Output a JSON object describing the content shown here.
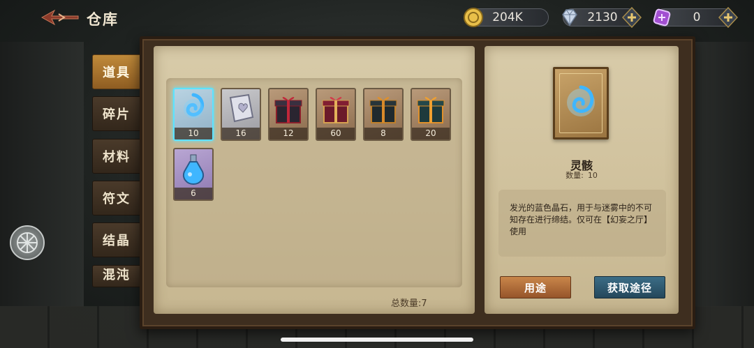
{
  "header": {
    "title": "仓库"
  },
  "resources": {
    "gold": {
      "value": "204K",
      "icon": "coin-icon",
      "color": "#e9c04a"
    },
    "gems": {
      "value": "2130",
      "icon": "diamond-icon",
      "color": "#c9d6e8"
    },
    "orbs": {
      "value": "0",
      "icon": "purple-crystal-icon",
      "color": "#a24fd1"
    }
  },
  "tabs": [
    {
      "label": "道具",
      "active": true
    },
    {
      "label": "碎片",
      "active": false
    },
    {
      "label": "材料",
      "active": false
    },
    {
      "label": "符文",
      "active": false
    },
    {
      "label": "结晶",
      "active": false
    },
    {
      "label": "混沌",
      "active": false
    }
  ],
  "items": [
    {
      "name": "spirit-remains",
      "count": "10",
      "selected": true,
      "icon": "blue-spirit-icon"
    },
    {
      "name": "heart-book",
      "count": "16",
      "selected": false,
      "icon": "silver-book-icon"
    },
    {
      "name": "gift-box-red",
      "count": "12",
      "selected": false,
      "icon": "gift-box-icon"
    },
    {
      "name": "gift-box-crimson",
      "count": "60",
      "selected": false,
      "icon": "gift-box-icon"
    },
    {
      "name": "gift-box-dark",
      "count": "8",
      "selected": false,
      "icon": "gift-box-icon"
    },
    {
      "name": "gift-box-teal",
      "count": "20",
      "selected": false,
      "icon": "gift-box-icon"
    },
    {
      "name": "potion-bottle",
      "count": "6",
      "selected": false,
      "icon": "potion-icon"
    }
  ],
  "inventory": {
    "total": "总数量:7"
  },
  "detail": {
    "name": "灵骸",
    "qty_label": "数量:",
    "qty_value": "10",
    "description": "发光的蓝色晶石，用于与迷雾中的不可知存在进行缔结。仅可在【幻妄之厅】使用",
    "use_button": "用途",
    "source_button": "获取途径"
  },
  "colors": {
    "accent_gold": "#c08a3a",
    "selected_border": "#5de3ff"
  }
}
